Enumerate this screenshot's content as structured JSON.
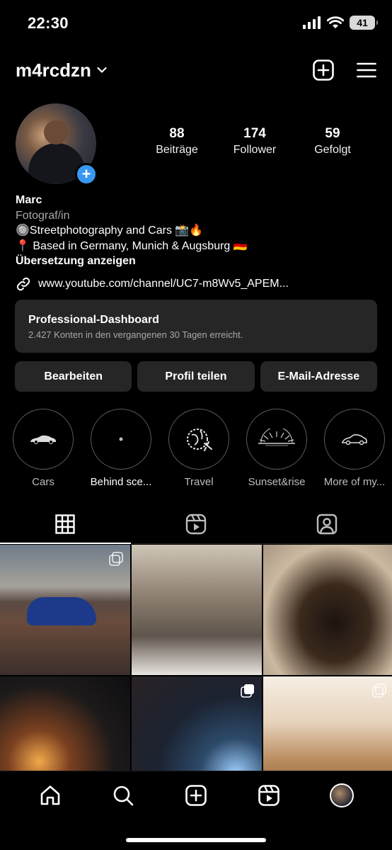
{
  "status_bar": {
    "time": "22:30",
    "battery": "41"
  },
  "header": {
    "username": "m4rcdzn"
  },
  "profile": {
    "stats": [
      {
        "value": "88",
        "label": "Beiträge"
      },
      {
        "value": "174",
        "label": "Follower"
      },
      {
        "value": "59",
        "label": "Gefolgt"
      }
    ],
    "name": "Marc",
    "category": "Fotograf/in",
    "bio_line1": "🔘Streetphotography and Cars 📸🔥",
    "bio_line2": "📍 Based in Germany, Munich & Augsburg 🇩🇪",
    "translate": "Übersetzung anzeigen",
    "link": "www.youtube.com/channel/UC7-m8Wv5_APEM..."
  },
  "dashboard": {
    "title": "Professional-Dashboard",
    "subtitle": "2.427 Konten in den vergangenen 30 Tagen erreicht."
  },
  "buttons": {
    "edit": "Bearbeiten",
    "share": "Profil teilen",
    "email": "E-Mail-Adresse"
  },
  "highlights": [
    {
      "label": "Cars",
      "icon": "car-icon"
    },
    {
      "label": "Behind sce...",
      "icon": "dot-icon"
    },
    {
      "label": "Travel",
      "icon": "globe-plane-icon"
    },
    {
      "label": "Sunset&rise",
      "icon": "sunrise-icon"
    },
    {
      "label": "More of my...",
      "icon": "car-outline-icon"
    }
  ],
  "tabs": [
    "grid-icon",
    "reels-icon",
    "tagged-icon"
  ],
  "bottom_nav": [
    "home-icon",
    "search-icon",
    "create-icon",
    "reels-icon",
    "profile-avatar"
  ]
}
